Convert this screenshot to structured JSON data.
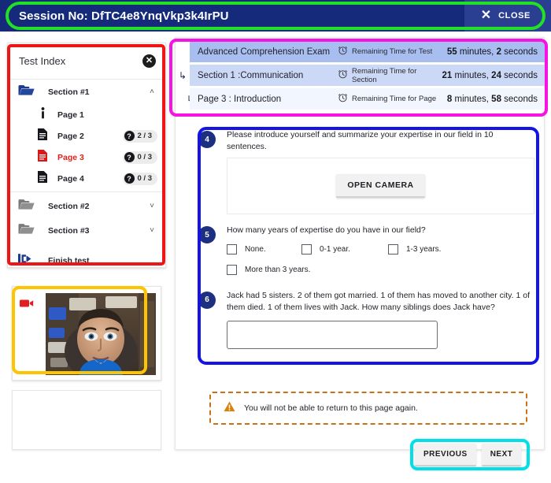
{
  "topbar": {
    "session_label": "Session No: DfTC4e8YnqVkp3k4IrPU",
    "close_x": "✕",
    "close_label": "CLOSE"
  },
  "index": {
    "title": "Test Index",
    "close_glyph": "✕",
    "sections": [
      {
        "label": "Section #1",
        "icon": "folder-open-icon",
        "chevron": "˄",
        "expanded": true,
        "pages": [
          {
            "label": "Page 1",
            "icon": "info-icon",
            "badge": null,
            "current": false
          },
          {
            "label": "Page 2",
            "icon": "document-icon",
            "badge": "2 / 3",
            "current": false
          },
          {
            "label": "Page 3",
            "icon": "document-icon-red",
            "badge": "0 / 3",
            "current": true
          },
          {
            "label": "Page 4",
            "icon": "document-icon",
            "badge": "0 / 3",
            "current": false
          }
        ]
      },
      {
        "label": "Section #2",
        "icon": "folder-closed-icon",
        "chevron": "˅",
        "expanded": false,
        "pages": []
      },
      {
        "label": "Section #3",
        "icon": "folder-closed-icon",
        "chevron": "˅",
        "expanded": false,
        "pages": []
      }
    ],
    "finish_label": "Finish test",
    "finish_icon": "exit-icon",
    "badge_qmark": "?"
  },
  "webcam": {
    "icon": "video-camera-icon"
  },
  "timers": [
    {
      "name": "Advanced Comprehension Exam",
      "label": "Remaining Time for Test",
      "value_num1": "55",
      "value_unit1": " minutes, ",
      "value_num2": "2",
      "value_unit2": " seconds",
      "arrow": "",
      "icon": "alarm-clock-icon"
    },
    {
      "name": "Section 1  :Communication",
      "label": "Remaining Time for Section",
      "value_num1": "21",
      "value_unit1": " minutes, ",
      "value_num2": "24",
      "value_unit2": " seconds",
      "arrow": "↳",
      "icon": "alarm-clock-icon"
    },
    {
      "name": "Page 3  : Introduction",
      "label": "Remaining Time for Page",
      "value_num1": "8",
      "value_unit1": " minutes, ",
      "value_num2": "58",
      "value_unit2": " seconds",
      "arrow": "↳",
      "icon": "alarm-clock-icon"
    }
  ],
  "questions": [
    {
      "number": "4",
      "text": "Please introduce yourself and summarize your expertise in our field in 10 sentences.",
      "open_camera_label": "OPEN CAMERA"
    },
    {
      "number": "5",
      "text": "How many years of expertise do you have in our field?",
      "options_row1": [
        "None.",
        "0-1 year.",
        "1-3 years."
      ],
      "options_row2": [
        "More than 3 years."
      ]
    },
    {
      "number": "6",
      "text": "Jack had 5 sisters. 2 of them got married. 1 of them has moved to another city. 1 of them died. 1 of them lives with Jack. How many siblings does Jack have?",
      "answer_value": "",
      "answer_placeholder": ""
    }
  ],
  "warning": {
    "icon": "warning-triangle-icon",
    "text": "You will not be able to return to this page again."
  },
  "nav": {
    "previous_label": "PREVIOUS",
    "next_label": "NEXT"
  },
  "colors": {
    "header_navy": "#152a7a",
    "badge_navy": "#1c2f80",
    "current_page_red": "#e0201b",
    "warning_orange": "#c87117",
    "timer_row1": "#a8bdf0",
    "timer_row2": "#ccd9f6",
    "timer_row3": "#f2f6fe"
  },
  "annotations": {
    "green": "#22e022",
    "red": "#ef1515",
    "yellow": "#ffc400",
    "magenta": "#f613e4",
    "blue": "#1414e6",
    "cyan": "#00e0e8"
  }
}
